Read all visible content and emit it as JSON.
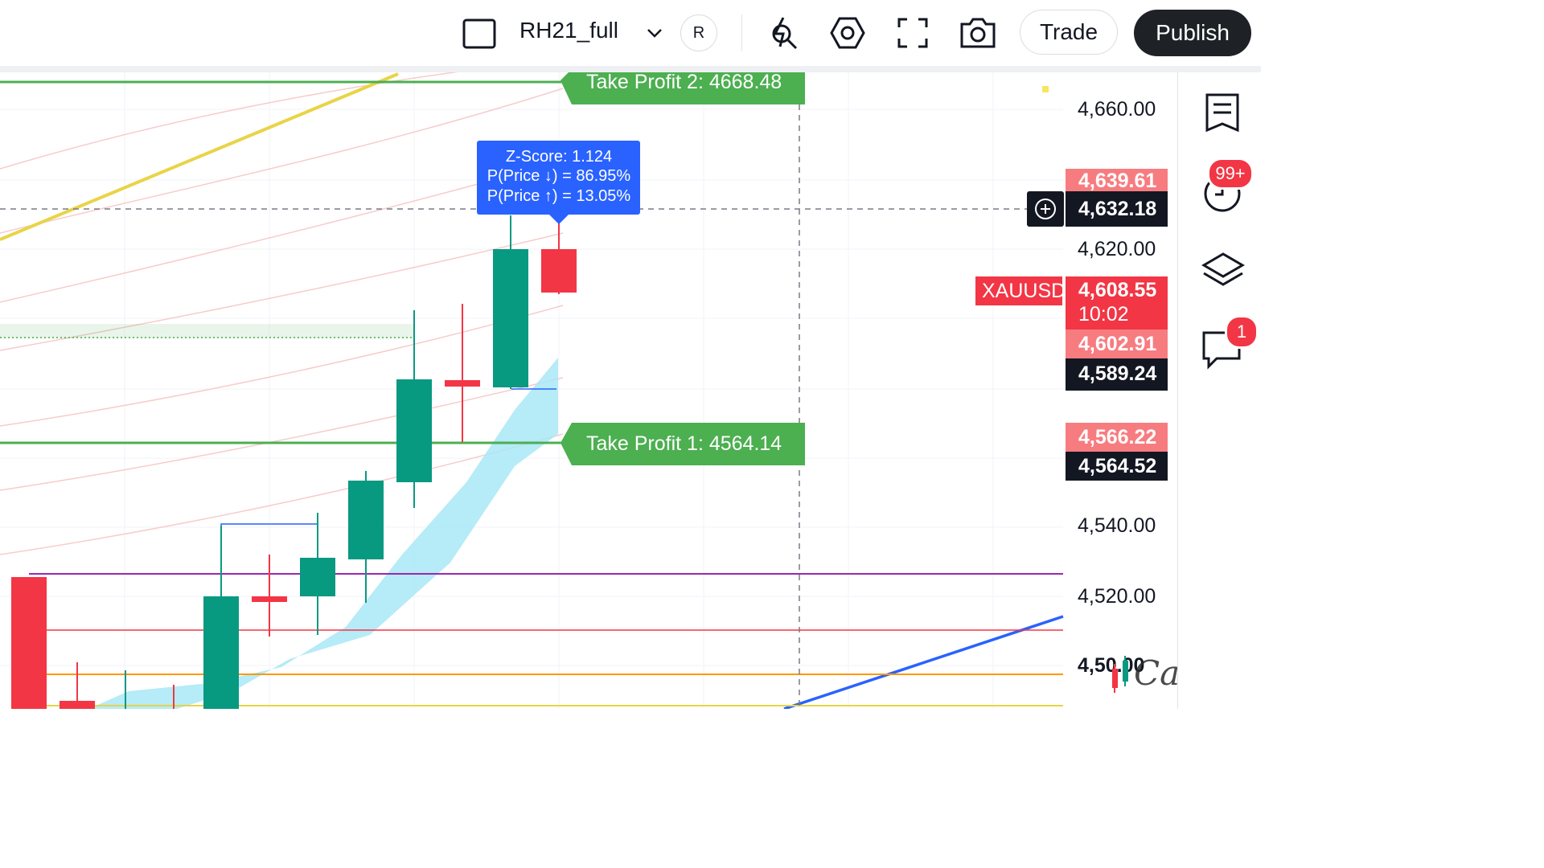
{
  "toolbar": {
    "symbol": "RH21_full",
    "replay_label": "R",
    "trade_label": "Trade",
    "publish_label": "Publish"
  },
  "chart": {
    "ticker_label": "XAUUSD",
    "countdown": "10:02",
    "price_axis": [
      "4,660.00",
      "4,620.00",
      "4,540.00",
      "4,520.00"
    ],
    "axis_partial_label": "4,5",
    "axis_partial_label_2": "0.00",
    "tags": {
      "tag_4639": "4,639.61",
      "tag_4632": "4,632.18",
      "tag_4608": "4,608.55",
      "tag_4602": "4,602.91",
      "tag_4589": "4,589.24",
      "tag_4566": "4,566.22",
      "tag_4564": "4,564.52"
    },
    "take_profit_2": "Take Profit 2: 4668.48",
    "take_profit_1": "Take Profit 1: 4564.14",
    "zscore": {
      "line1": "Z-Score: 1.124",
      "line2": "P(Price ↓) = 86.95%",
      "line3": "P(Price ↑) = 13.05%"
    },
    "watermark": "Cafefx"
  },
  "sidebar": {
    "alerts_badge": "99+",
    "chat_badge": "1"
  },
  "colors": {
    "up": "#089981",
    "down": "#f23645",
    "take_profit": "#4caf50",
    "zscore_box": "#2962ff",
    "dark_tag": "#131722"
  }
}
